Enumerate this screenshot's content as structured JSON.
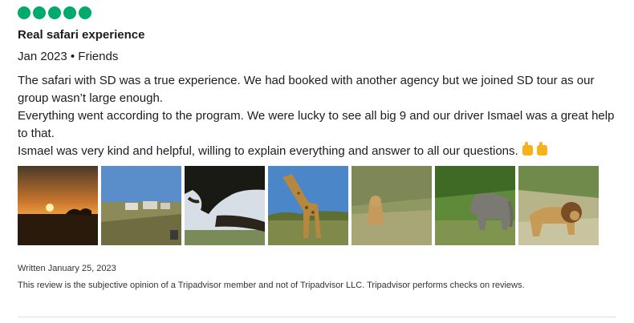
{
  "review": {
    "rating": {
      "bubbles_filled": 5,
      "bubbles_total": 5,
      "color": "#00aa6c"
    },
    "title": "Real safari experience",
    "trip": "Jan 2023 • Friends",
    "body": {
      "line1": "The safari with SD was a true experience. We had booked with another agency but we joined SD tour as our group wasn’t large enough.",
      "line2": "Everything went according to the program. We were lucky to see all big 9 and our driver Ismael was a great help to that.",
      "line3": "Ismael was very kind and helpful, willing to explain everything and answer to all our questions.",
      "emoji": [
        "thumbs-up-icon",
        "thumbs-up-icon"
      ]
    },
    "photos": [
      {
        "icon": "sunset-photo"
      },
      {
        "icon": "safari-vehicles-photo"
      },
      {
        "icon": "leopard-in-tree-photo"
      },
      {
        "icon": "giraffe-photo"
      },
      {
        "icon": "lioness-photo"
      },
      {
        "icon": "elephant-photo"
      },
      {
        "icon": "lion-photo"
      }
    ],
    "written": "Written January 25, 2023",
    "disclaimer": "This review is the subjective opinion of a Tripadvisor member and not of Tripadvisor LLC. Tripadvisor performs checks on reviews."
  }
}
